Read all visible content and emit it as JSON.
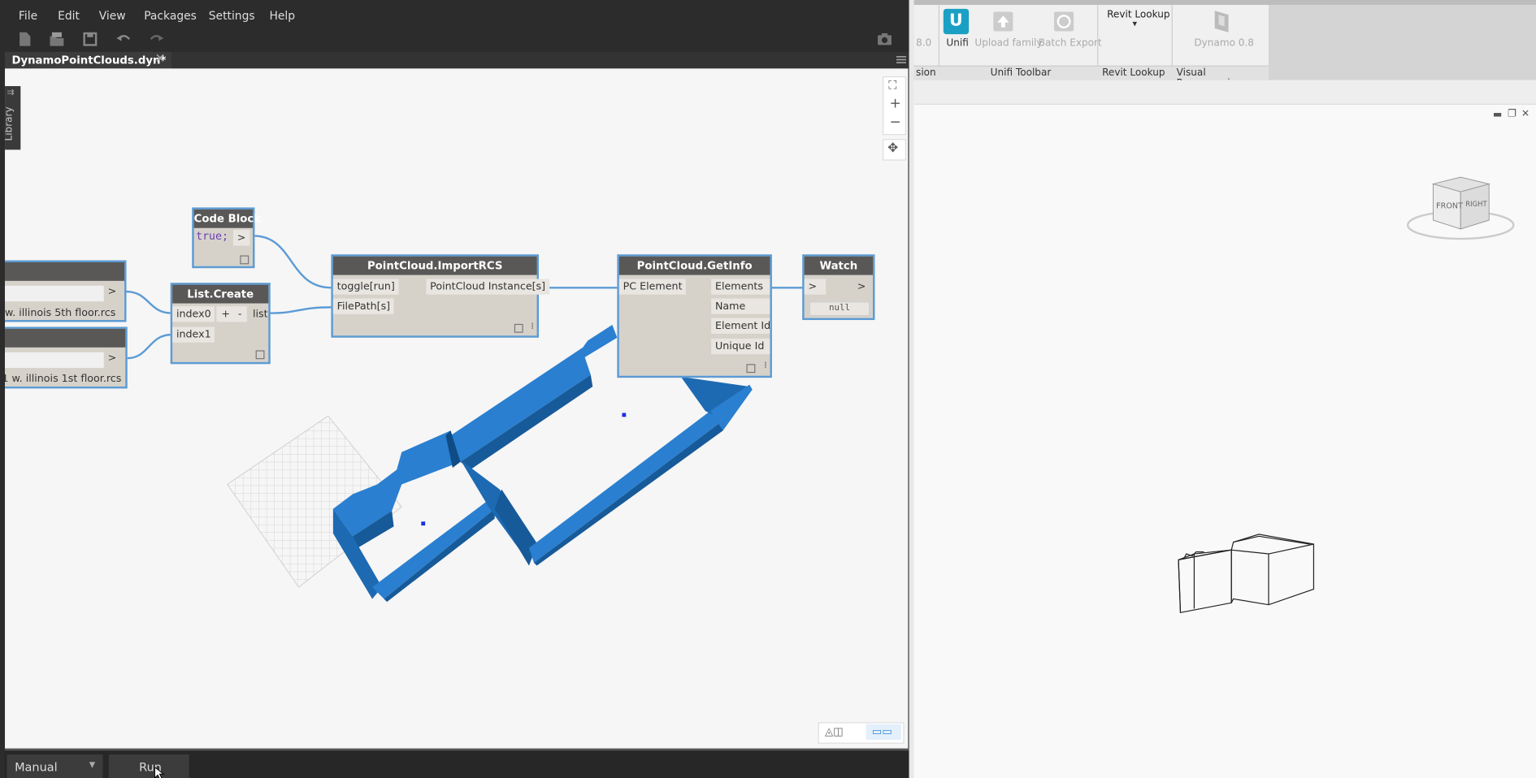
{
  "dynamo": {
    "menu": [
      "File",
      "Edit",
      "View",
      "Packages",
      "Settings",
      "Help"
    ],
    "tab_title": "DynamoPointClouds.dyn*",
    "library_label": "Library",
    "nodes": {
      "filepath1": {
        "value": "w. illinois 5th floor.rcs",
        "out": ">"
      },
      "filepath2": {
        "value": "1 w. illinois 1st floor.rcs",
        "out": ">"
      },
      "code_block": {
        "title": "Code Block",
        "code": "true;",
        "out": ">"
      },
      "list_create": {
        "title": "List.Create",
        "in0": "index0",
        "in1": "index1",
        "plus": "+",
        "minus": "-",
        "out": "list"
      },
      "import_rcs": {
        "title": "PointCloud.ImportRCS",
        "in0": "toggle[run]",
        "in1": "FilePath[s]",
        "out": "PointCloud Instance[s]"
      },
      "get_info": {
        "title": "PointCloud.GetInfo",
        "in0": "PC Element",
        "outs": [
          "Elements",
          "Name",
          "Element Id",
          "Unique Id"
        ]
      },
      "watch": {
        "title": "Watch",
        "in": ">",
        "out": ">",
        "value": "null"
      }
    },
    "run_mode": "Manual",
    "run_label": "Run"
  },
  "revit": {
    "buttons": {
      "version_partial": "8.0",
      "unifi": "Unifi",
      "upload_family": "Upload family",
      "batch_export": "Batch Export",
      "revit_lookup": "Revit Lookup",
      "dynamo": "Dynamo 0.8"
    },
    "panels": {
      "version_partial": "sion",
      "unifi_toolbar": "Unifi Toolbar",
      "revit_lookup": "Revit Lookup",
      "visual_programming": "Visual Programming"
    },
    "viewcube": {
      "front": "FRONT",
      "right": "RIGHT"
    }
  },
  "colors": {
    "accent": "#5b9bd5",
    "geometry": "#1f6fb8",
    "node_header": "#595857",
    "node_body": "#d6d2ca"
  }
}
